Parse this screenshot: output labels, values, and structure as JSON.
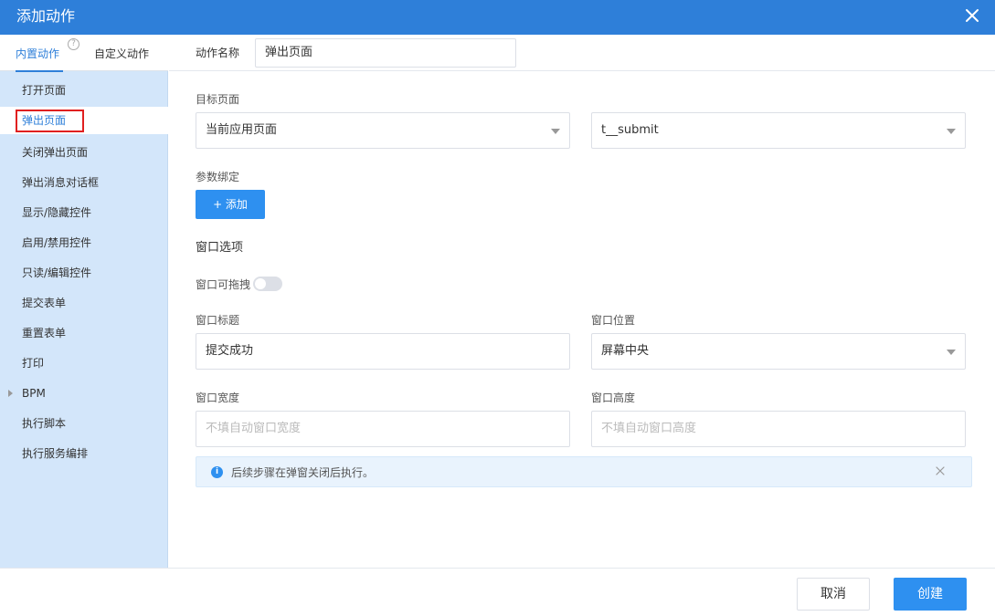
{
  "dialog": {
    "title": "添加动作"
  },
  "tabs": {
    "builtin": "内置动作",
    "custom": "自定义动作",
    "help_glyph": "?"
  },
  "menu": [
    "打开页面",
    "弹出页面",
    "关闭弹出页面",
    "弹出消息对话框",
    "显示/隐藏控件",
    "启用/禁用控件",
    "只读/编辑控件",
    "提交表单",
    "重置表单",
    "打印",
    "BPM",
    "执行脚本",
    "执行服务编排"
  ],
  "selected_menu_item": "弹出页面",
  "form": {
    "action_name_label": "动作名称",
    "action_name_value": "弹出页面",
    "target_page_label": "目标页面",
    "target_app_value": "当前应用页面",
    "target_page_value": "t__submit",
    "param_binding_label": "参数绑定",
    "add_button": "+ 添加",
    "window_options_title": "窗口选项",
    "draggable_label": "窗口可拖拽",
    "draggable_on": false,
    "window_title_label": "窗口标题",
    "window_title_value": "提交成功",
    "window_position_label": "窗口位置",
    "window_position_value": "屏幕中央",
    "window_width_label": "窗口宽度",
    "window_width_placeholder": "不填自动窗口宽度",
    "window_height_label": "窗口高度",
    "window_height_placeholder": "不填自动窗口高度"
  },
  "notice": {
    "icon_glyph": "i",
    "message": "后续步骤在弹窗关闭后执行。"
  },
  "footer": {
    "cancel": "取消",
    "create": "创建"
  },
  "colors": {
    "primary": "#2e7fd9",
    "button": "#2e90f0",
    "sidebar": "#d3e6fa",
    "highlight_border": "#e02020"
  }
}
